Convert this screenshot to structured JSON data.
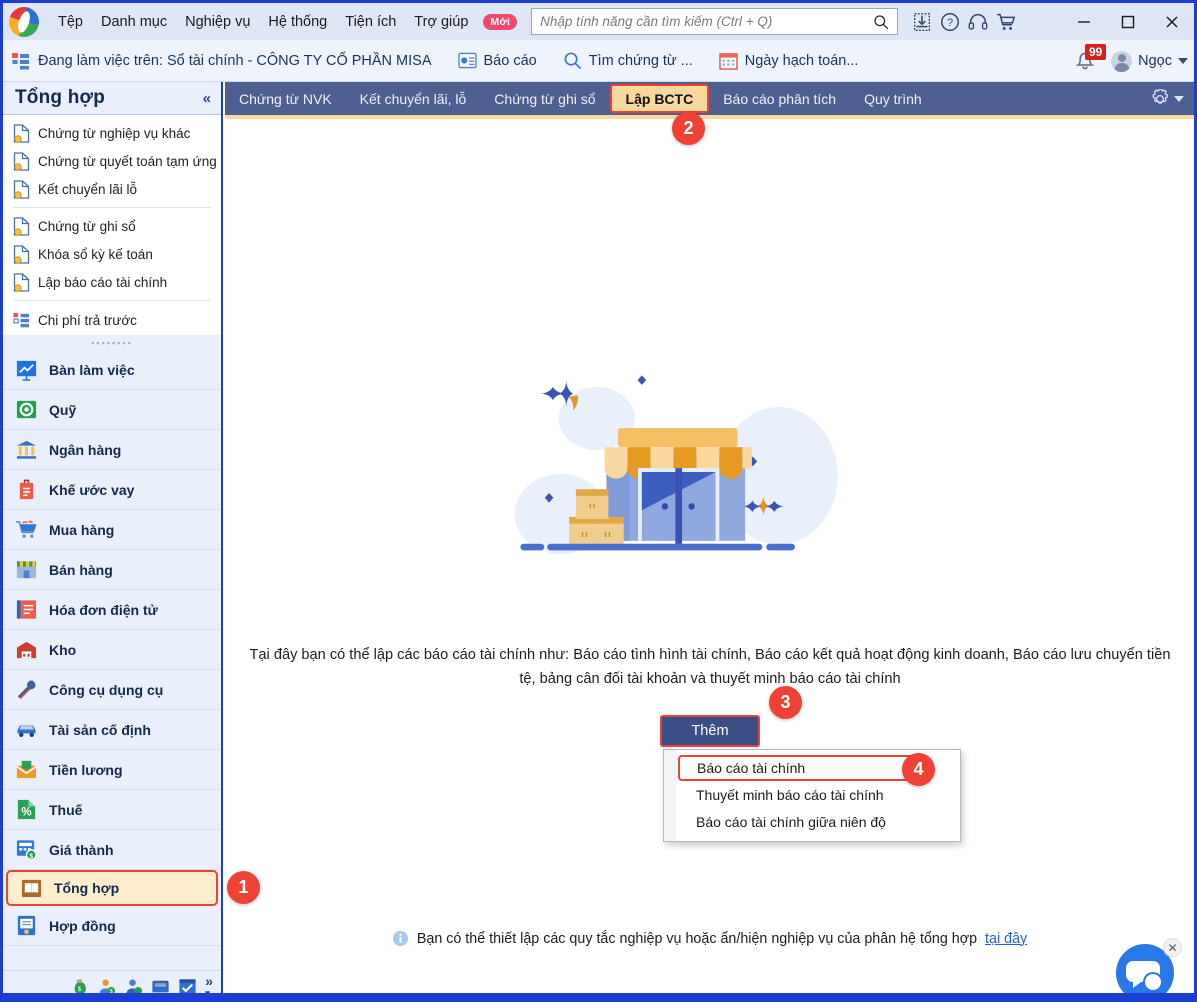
{
  "window": {
    "title": "MISA",
    "controls": {
      "minimize": "–",
      "maximize": "□",
      "close": "✕"
    }
  },
  "menubar": {
    "items": [
      {
        "label": "Tệp",
        "name": "menu-tep"
      },
      {
        "label": "Danh mục",
        "name": "menu-danh-muc"
      },
      {
        "label": "Nghiệp vụ",
        "name": "menu-nghiep-vu"
      },
      {
        "label": "Hệ thống",
        "name": "menu-he-thong"
      },
      {
        "label": "Tiện ích",
        "name": "menu-tien-ich"
      },
      {
        "label": "Trợ giúp",
        "name": "menu-tro-giup"
      }
    ],
    "new_badge": "Mới",
    "search_placeholder": "Nhập tính năng cần tìm kiếm (Ctrl + Q)",
    "search_value": "",
    "icons": [
      "download-icon",
      "help-icon",
      "headset-icon",
      "cart-icon"
    ]
  },
  "toolbar": {
    "context_label": "Đang làm việc trên: Sổ tài chính - CÔNG TY CỔ PHẦN MISA",
    "report_label": "Báo cáo",
    "find_voucher_label": "Tìm chứng từ ...",
    "posting_date_label": "Ngày hạch toán...",
    "notification_count": "99",
    "user_name": "Ngọc"
  },
  "sidebar": {
    "title": "Tổng hợp",
    "collapse_icon": "«",
    "links_group1": [
      "Chứng từ nghiệp vụ khác",
      "Chứng từ quyết toán tạm ứng",
      "Kết chuyển lãi lỗ"
    ],
    "links_group2": [
      "Chứng từ ghi sổ",
      "Khóa sổ kỳ kế toán",
      "Lập báo cáo tài chính"
    ],
    "links_group3": [
      "Chi phí trả trước"
    ],
    "modules": [
      {
        "label": "Bàn làm việc",
        "icon": "workdesk-icon",
        "active": false
      },
      {
        "label": "Quỹ",
        "icon": "safe-icon",
        "active": false
      },
      {
        "label": "Ngân hàng",
        "icon": "bank-icon",
        "active": false
      },
      {
        "label": "Khế ước vay",
        "icon": "loan-icon",
        "active": false
      },
      {
        "label": "Mua hàng",
        "icon": "purchase-cart-icon",
        "active": false
      },
      {
        "label": "Bán hàng",
        "icon": "sales-shop-icon",
        "active": false
      },
      {
        "label": "Hóa đơn điện tử",
        "icon": "einvoice-icon",
        "active": false
      },
      {
        "label": "Kho",
        "icon": "warehouse-icon",
        "active": false
      },
      {
        "label": "Công cụ dụng cụ",
        "icon": "tools-icon",
        "active": false
      },
      {
        "label": "Tài sản cố định",
        "icon": "car-icon",
        "active": false
      },
      {
        "label": "Tiền lương",
        "icon": "payroll-icon",
        "active": false
      },
      {
        "label": "Thuế",
        "icon": "tax-percent-icon",
        "active": false
      },
      {
        "label": "Giá thành",
        "icon": "cost-icon",
        "active": false
      },
      {
        "label": "Tổng hợp",
        "icon": "ledger-book-icon",
        "active": true
      },
      {
        "label": "Hợp đồng",
        "icon": "contract-icon",
        "active": false
      }
    ],
    "footer_icons": [
      "money-bag-icon",
      "customer-icon",
      "supplier-icon",
      "inbox-icon",
      "checklist-icon",
      "more-chevron-icon"
    ]
  },
  "tabs": [
    {
      "label": "Chứng từ NVK",
      "active": false
    },
    {
      "label": "Kết chuyển lãi, lỗ",
      "active": false
    },
    {
      "label": "Chứng từ ghi sổ",
      "active": false
    },
    {
      "label": "Lập BCTC",
      "active": true
    },
    {
      "label": "Báo cáo phân tích",
      "active": false
    },
    {
      "label": "Quy trình",
      "active": false
    }
  ],
  "main": {
    "description": "Tại đây bạn có thể lập các báo cáo tài chính như: Báo cáo tình hình tài chính, Báo cáo kết quả hoạt động kinh doanh, Báo cáo lưu chuyển tiền tệ, bảng cân đối tài khoản và thuyết minh báo cáo tài chính",
    "add_button": "Thêm",
    "dropdown_items": [
      {
        "label": "Báo cáo tài chính",
        "highlighted": true
      },
      {
        "label": "Thuyết minh báo cáo tài chính",
        "highlighted": false
      },
      {
        "label": "Báo cáo tài chính giữa niên độ",
        "highlighted": false
      }
    ],
    "hint_text": "Bạn có thể thiết lập các quy tắc nghiệp vụ hoặc ẩn/hiện nghiệp vụ của phân hệ tổng hợp",
    "hint_link": "tại đây",
    "illustration": "storefront-with-boxes-illustration"
  },
  "markers": {
    "one": "1",
    "two": "2",
    "three": "3",
    "four": "4"
  },
  "colors": {
    "accent_blue": "#1a3fd0",
    "tab_bar": "#4e5f92",
    "active_tab": "#f6d99b",
    "highlight_red": "#ef4136",
    "button_navy": "#3b4f87",
    "notification_red": "#d32020"
  }
}
